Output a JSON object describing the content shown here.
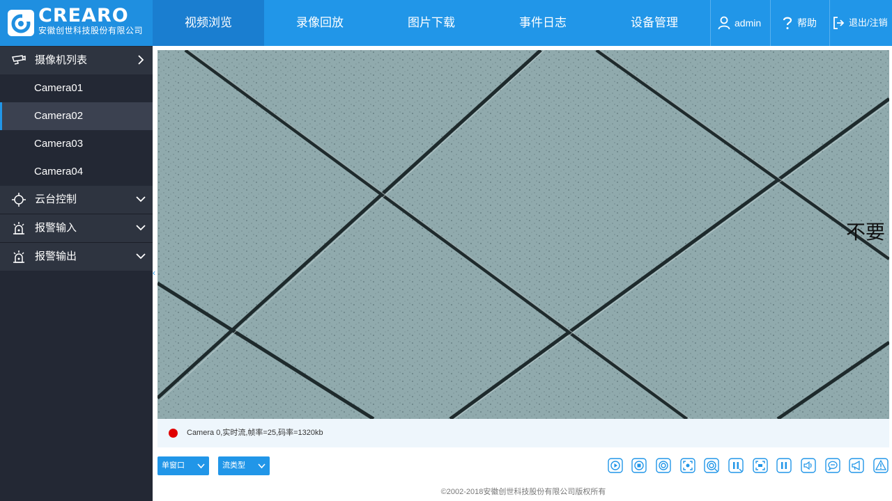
{
  "brand": {
    "name": "CREARO",
    "company": "安徽创世科技股份有限公司",
    "accent": "#2196e8"
  },
  "nav": {
    "items": [
      {
        "label": "视频浏览",
        "active": true
      },
      {
        "label": "录像回放",
        "active": false
      },
      {
        "label": "图片下载",
        "active": false
      },
      {
        "label": "事件日志",
        "active": false
      },
      {
        "label": "设备管理",
        "active": false
      }
    ]
  },
  "header_right": {
    "user": "admin",
    "help": "帮助",
    "logout": "退出/注销"
  },
  "sidebar": {
    "camera_list_title": "摄像机列表",
    "cameras": [
      "Camera01",
      "Camera02",
      "Camera03",
      "Camera04"
    ],
    "selected_camera": "Camera02",
    "ptz": "云台控制",
    "alarm_in": "报警输入",
    "alarm_out": "报警输出"
  },
  "video": {
    "overlay_text": "不要",
    "status": "Camera 0,实时流,帧率=25,码率=1320kb",
    "status_color": "#e00000"
  },
  "controls": {
    "window_mode": "单窗口",
    "stream_type": "流类型",
    "tools": [
      "play-icon",
      "stop-icon",
      "snapshot-icon",
      "capture-icon",
      "record-icon",
      "pause-icon",
      "fullscreen-icon",
      "pause-all-icon",
      "volume-icon",
      "talk-icon",
      "broadcast-icon",
      "alarm-icon"
    ]
  },
  "footer": "©2002-2018安徽创世科技股份有限公司版权所有"
}
